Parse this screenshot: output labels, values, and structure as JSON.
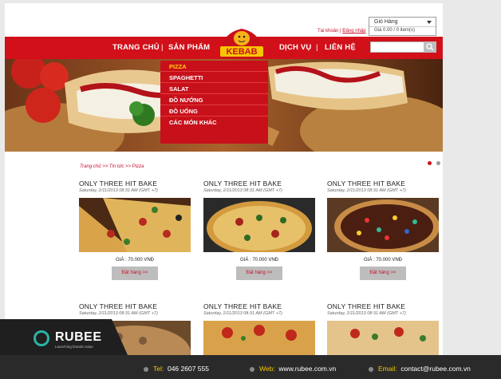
{
  "account": {
    "label": "Tài khoản",
    "separator": "|",
    "login": "Đăng nhập"
  },
  "cart": {
    "title": "Giỏ Hàng",
    "total": "Giá 0.00",
    "items": "/ 0 item(s)"
  },
  "nav": {
    "items": [
      "TRANG CHỦ",
      "SẢN PHẨM",
      "DỊCH VỤ",
      "LIÊN HỆ"
    ],
    "separator": "|"
  },
  "logo": {
    "text": "KEBAB"
  },
  "dropdown": {
    "items": [
      "PIZZA",
      "SPAGHETTI",
      "SALAT",
      "ĐỒ NƯỚNG",
      "ĐỒ UỐNG",
      "CÁC MÓN KHÁC"
    ],
    "active": 0
  },
  "breadcrumb": "Trang chủ >> Tin tức >> Pizza",
  "products": [
    {
      "title": "ONLY THREE HIT BAKE",
      "date": "Saturday, 2/11/2013 08:31 AM (GMT +7)",
      "price": "GIÁ : 70.000 VNĐ",
      "button": "Đặt hàng >>",
      "image": "pizza-slices-photo"
    },
    {
      "title": "ONLY THREE HIT BAKE",
      "date": "Saturday, 2/11/2013 08:31 AM (GMT +7)",
      "price": "GIÁ : 70.000 VNĐ",
      "button": "Đặt hàng >>",
      "image": "whole-pizza-photo"
    },
    {
      "title": "ONLY THREE HIT BAKE",
      "date": "Saturday, 2/11/2013 08:31 AM (GMT +7)",
      "price": "GIÁ : 70.000 VNĐ",
      "button": "Đặt hàng >>",
      "image": "chocolate-candy-pizza-photo"
    },
    {
      "title": "ONLY THREE HIT BAKE",
      "date": "Saturday, 2/11/2013 08:31 AM (GMT +7)",
      "image": "mushroom-pizza-photo"
    },
    {
      "title": "ONLY THREE HIT BAKE",
      "date": "Saturday, 2/11/2013 08:31 AM (GMT +7)",
      "image": "pepperoni-pizza-photo"
    },
    {
      "title": "ONLY THREE HIT BAKE",
      "date": "Saturday, 2/11/2013 08:31 AM (GMT +7)",
      "image": "veggie-pizza-photo"
    }
  ],
  "brand": {
    "name": "RUBEE",
    "tagline": "Launching brands value"
  },
  "footer": {
    "tel_label": "Tel:",
    "tel": "046 2607 555",
    "web_label": "Web:",
    "web": "www.rubee.com.vn",
    "email_label": "Email:",
    "email": "contact@rubee.com.vn"
  },
  "colors": {
    "brand_red": "#d1101a",
    "accent_yellow": "#f7c600"
  }
}
